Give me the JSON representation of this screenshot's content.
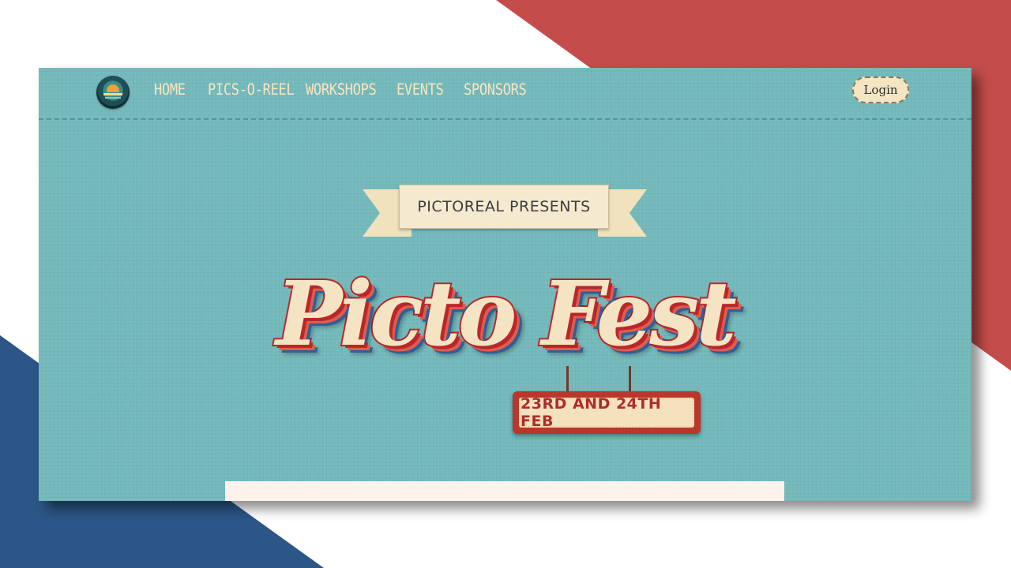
{
  "nav": {
    "links": [
      "Home",
      "Pics-O-Reel",
      "Workshops",
      "Events",
      "Sponsors"
    ],
    "login_label": "Login"
  },
  "hero": {
    "ribbon": "Pictoreal Presents",
    "title": "Picto Fest",
    "date": "23RD AND 24TH FEB"
  },
  "colors": {
    "background_teal": "#74b9bb",
    "accent_red": "#b8282a",
    "cream": "#f5e4c3",
    "decor_red": "#c44d4b",
    "decor_blue": "#2b5687"
  }
}
